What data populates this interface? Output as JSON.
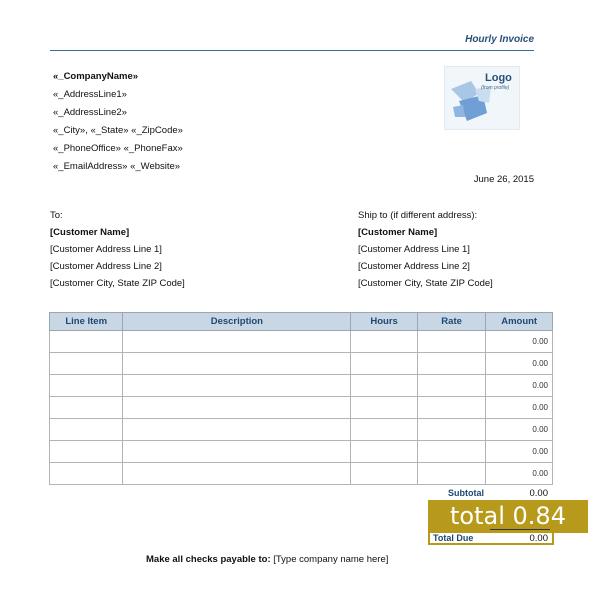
{
  "header": {
    "title": "Hourly Invoice"
  },
  "company": {
    "name": "«_CompanyName»",
    "address_line1": "«_AddressLine1»",
    "address_line2": "«_AddressLine2»",
    "city_state_zip": "«_City», «_State» «_ZipCode»",
    "phone_fax": "«_PhoneOffice» «_PhoneFax»",
    "email_website": "«_EmailAddress» «_Website»"
  },
  "logo": {
    "title": "Logo",
    "subtitle": "(from profile)"
  },
  "date": "June 26, 2015",
  "bill_to": {
    "label": "To:",
    "name": "[Customer Name]",
    "address1": "[Customer Address Line 1]",
    "address2": "[Customer Address Line 2]",
    "city": "[Customer City, State ZIP Code]"
  },
  "ship_to": {
    "label": "Ship to (if different address):",
    "name": "[Customer Name]",
    "address1": "[Customer Address Line 1]",
    "address2": "[Customer Address Line 2]",
    "city": "[Customer City, State ZIP Code]"
  },
  "table": {
    "columns": [
      "Line Item",
      "Description",
      "Hours",
      "Rate",
      "Amount"
    ],
    "rows": [
      [
        "",
        "",
        "",
        "",
        "0.00"
      ],
      [
        "",
        "",
        "",
        "",
        "0.00"
      ],
      [
        "",
        "",
        "",
        "",
        "0.00"
      ],
      [
        "",
        "",
        "",
        "",
        "0.00"
      ],
      [
        "",
        "",
        "",
        "",
        "0.00"
      ],
      [
        "",
        "",
        "",
        "",
        "0.00"
      ],
      [
        "",
        "",
        "",
        "",
        "0.00"
      ]
    ]
  },
  "totals": {
    "subtotal_label": "Subtotal",
    "subtotal_value": "0.00",
    "total_due_label": "Total Due",
    "total_due_value": "0.00"
  },
  "overlay": {
    "text": "total 0.84"
  },
  "footer": {
    "payable_label": "Make all checks payable to:",
    "payable_value": "[Type company name here]"
  }
}
